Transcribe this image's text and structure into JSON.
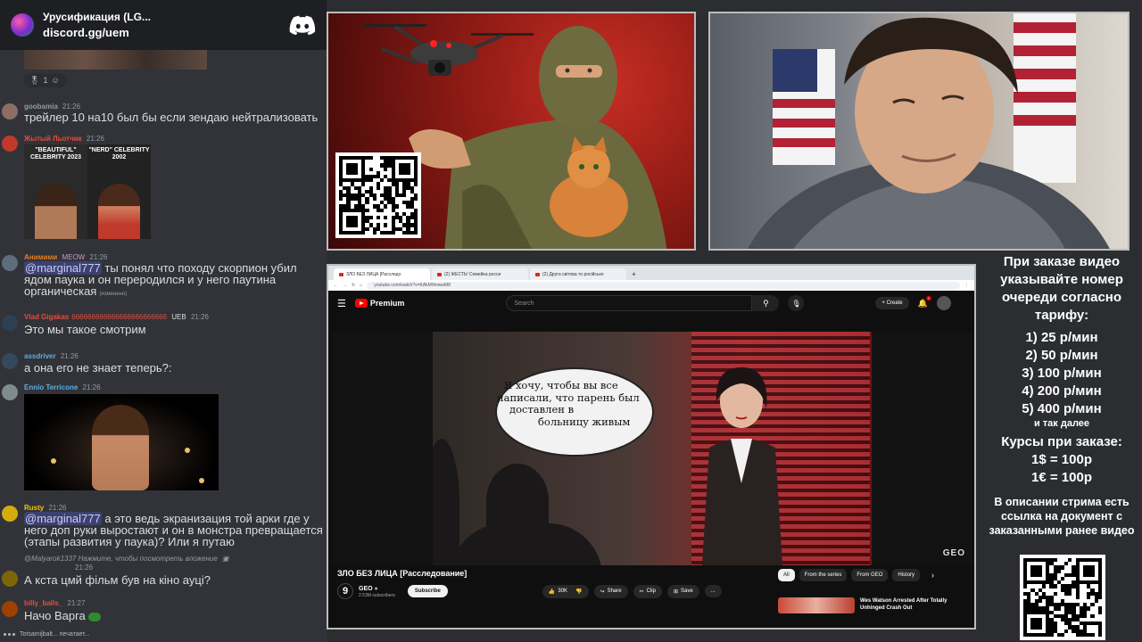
{
  "discord": {
    "server_name": "Урусификация (LG...",
    "server_link": "discord.gg/uem",
    "reaction": {
      "count": "1"
    },
    "messages": [
      {
        "user": "goobamia",
        "time": "21:26",
        "text": "трейлер 10 на10 был бы если зендаю нейтрализовать",
        "color": "#949ba4"
      },
      {
        "user": "Жытый Льотчик",
        "time": "21:26",
        "meme": {
          "left": "\"BEAUTIFUL\" CELEBRITY 2023",
          "right": "\"NERD\" CELEBRITY 2002"
        },
        "color": "#e74c3c"
      },
      {
        "user": "Анимими",
        "badge": "MEOW",
        "time": "21:26",
        "mention": "@marginal777",
        "text": " ты понял что походу скорпион убил ядом паука и он переродился и у него паутина органическая",
        "edited": "(изменено)",
        "color": "#e67e22"
      },
      {
        "user": "Vlad Gigakas",
        "extra": "666666666666666666666666",
        "tag": "UEB",
        "time": "21:26",
        "text": "Это мы такое смотрим",
        "color": "#e74c3c"
      },
      {
        "user": "assdriver",
        "time": "21:26",
        "text": "а она его не знает теперь?:",
        "color": "#5dade2"
      },
      {
        "user": "Ennio Terricone",
        "time": "21:26",
        "color": "#5dade2"
      },
      {
        "user": "Rusty",
        "time": "21:26",
        "mention": "@marginal777",
        "text": " а это ведь экранизация той арки где у него доп руки выростают и он в монстра превращается (этапы развития у паука)? Или я путаю",
        "color": "#f1c40f"
      },
      {
        "reply": "@Malyarok1337 Нажмите, чтобы посмотреть вложение",
        "time": "21:26",
        "text": "А кста цмй фільм був на кіно ауці?"
      },
      {
        "user": "billy_balls_",
        "time": "21:27",
        "text": "Начо Варга",
        "color": "#e74c3c"
      }
    ],
    "typing": "Totsamijbalt... печатает..."
  },
  "browser": {
    "tabs": [
      "ЗЛО БЕЗ ЛИЦА [Расследо",
      "(2) ЖЕСТЬ! Семейка росси",
      "(2) Друга світова то російсько"
    ],
    "url": "youtube.com/watch?v=KAkM9mwwM8",
    "youtube": {
      "logo_text": "Premium",
      "search_placeholder": "Search",
      "create_label": "Create",
      "notif_count": "2",
      "bubble_lines": [
        "Я хочу, чтобы вы все",
        "написали, что парень был",
        "доставлен в",
        "больницу живым"
      ],
      "watermark": "GEO",
      "video_title": "ЗЛО БЕЗ ЛИЦА [Расследование]",
      "channel_name": "GEO",
      "channel_logo": "9",
      "subscribers": "2.53M subscribers",
      "subscribe_label": "Subscribe",
      "likes": "30K",
      "share_label": "Share",
      "clip_label": "Clip",
      "save_label": "Save",
      "more_label": "...",
      "chips": [
        "All",
        "From the series",
        "From GEO",
        "History"
      ],
      "rec_title": "Wes Watson Arrested After Totally Unhinged Crash Out"
    }
  },
  "info": {
    "intro": "При заказе видео указывайте номер очереди согласно тарифу:",
    "tariffs": [
      "1) 25 р/мин",
      "2) 50 р/мин",
      "3) 100 р/мин",
      "4) 200 р/мин",
      "5) 400 р/мин"
    ],
    "etc": "и так далее",
    "rates_title": "Курсы при заказе:",
    "rates": [
      "1$ = 100р",
      "1€ = 100р"
    ],
    "footer": "В описании стрима есть ссылка на документ с заказанными ранее видео"
  },
  "colors": {
    "youtube_red": "#ff0000",
    "discord_bg": "#313338",
    "panel_border": "#bcbcbc"
  },
  "icons": [
    "discord-icon",
    "search-icon",
    "mic-icon",
    "bell-icon",
    "like-icon",
    "dislike-icon",
    "share-icon",
    "clip-icon",
    "save-icon",
    "qr-code"
  ]
}
